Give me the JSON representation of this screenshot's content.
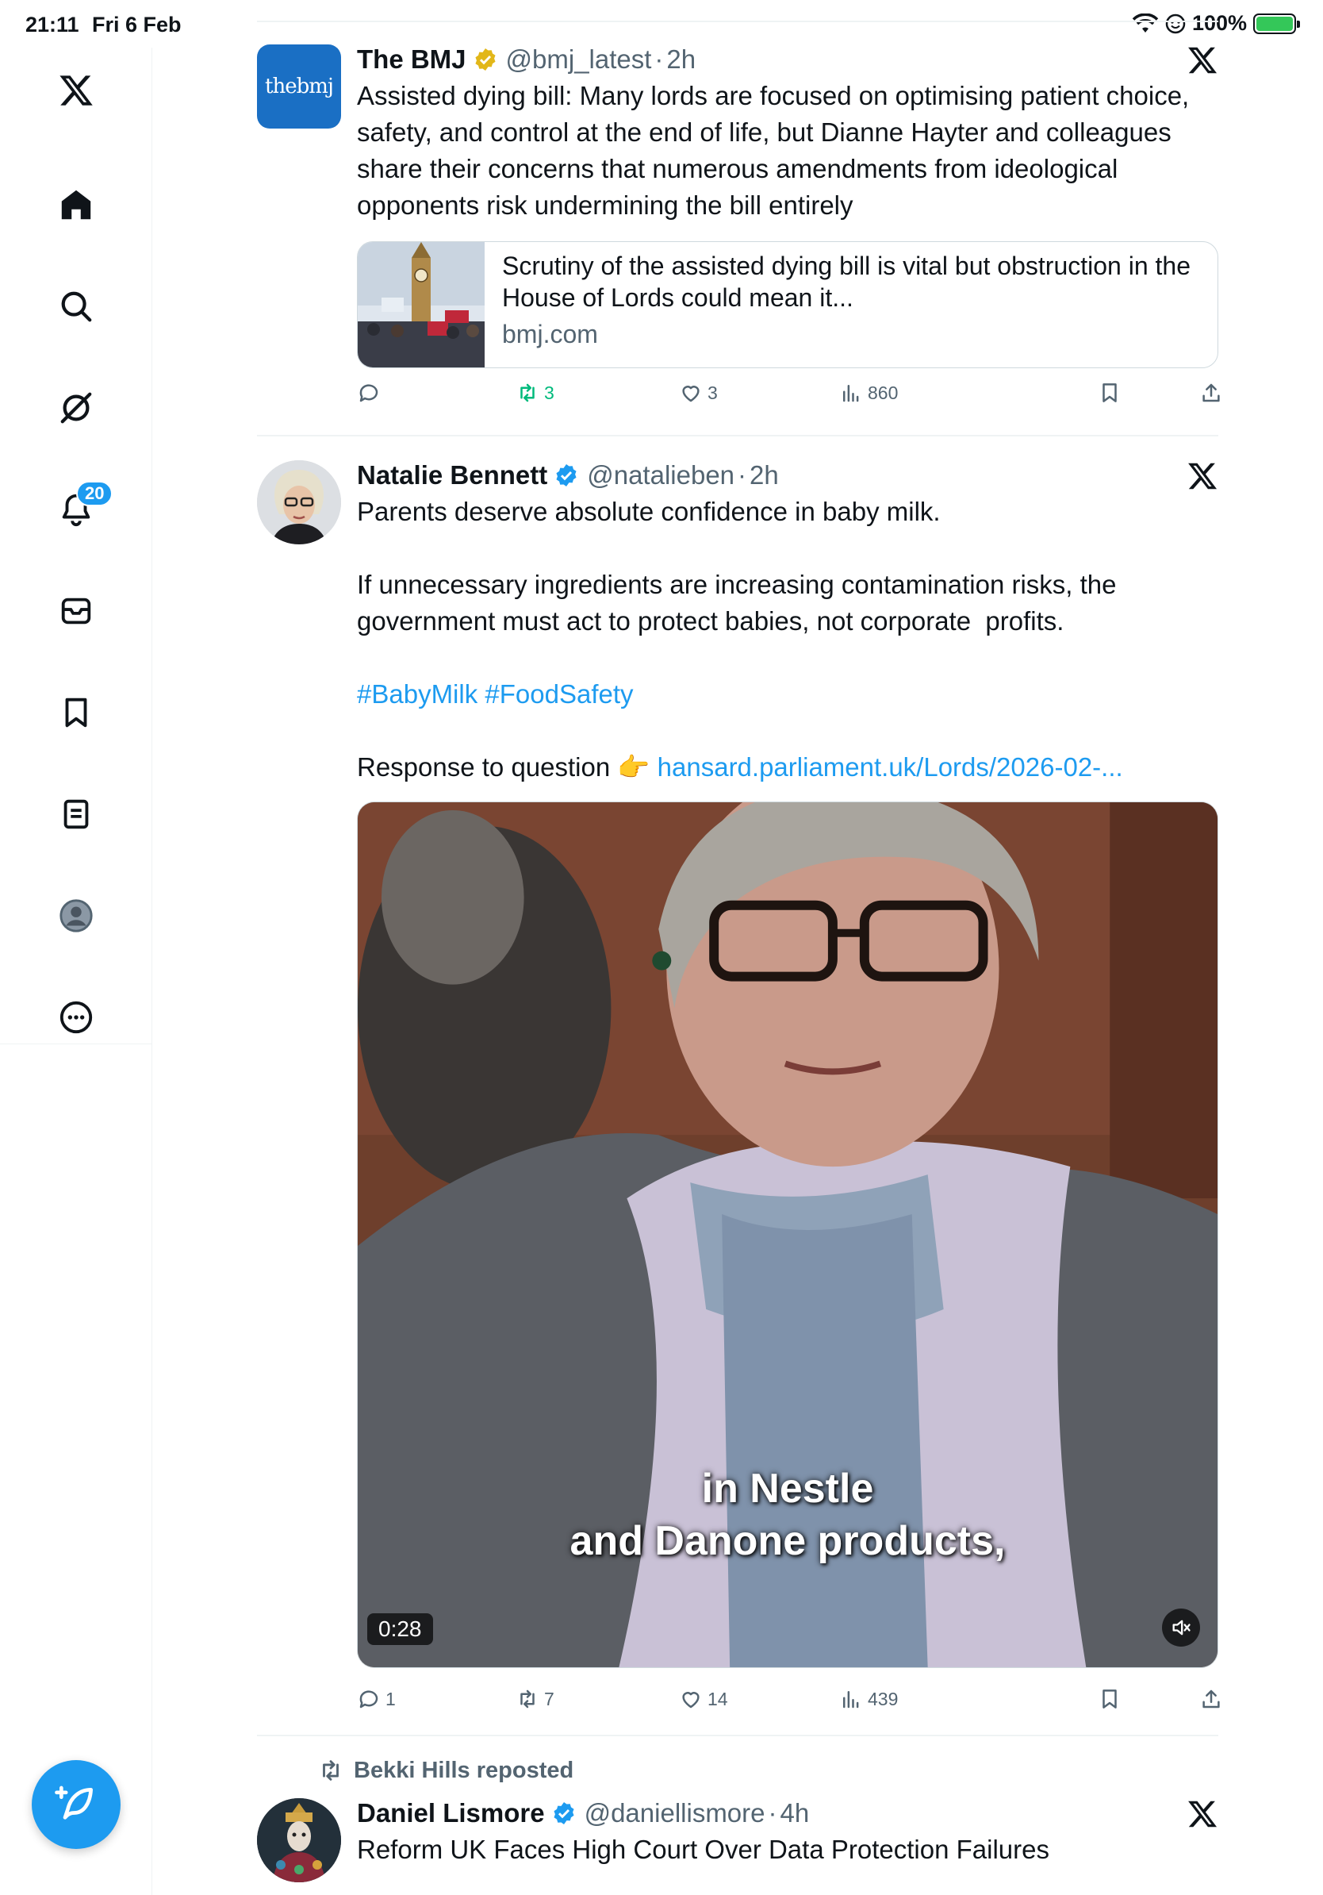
{
  "status_bar": {
    "time": "21:11",
    "date": "Fri 6 Feb",
    "battery": "100%"
  },
  "sidebar": {
    "items": [
      {
        "name": "x-logo"
      },
      {
        "name": "home"
      },
      {
        "name": "search"
      },
      {
        "name": "grok"
      },
      {
        "name": "notifications",
        "badge": "20"
      },
      {
        "name": "messages"
      },
      {
        "name": "bookmarks"
      },
      {
        "name": "lists"
      },
      {
        "name": "profile"
      },
      {
        "name": "more"
      }
    ]
  },
  "tweets": [
    {
      "name": "The BMJ",
      "handle": "@bmj_latest",
      "time": "2h",
      "avatar_text": "thebmj",
      "text": "Assisted dying bill: Many lords are focused on optimising patient choice, safety, and control at the end of life, but Dianne Hayter and colleagues share their concerns that numerous amendments from ideological opponents risk undermining the bill entirely",
      "card": {
        "title": "Scrutiny of the assisted dying bill is vital but obstruction in the House of Lords could mean it...",
        "domain": "bmj.com"
      },
      "stats": {
        "reposts": "3",
        "likes": "3",
        "views": "860"
      }
    },
    {
      "name": "Natalie Bennett",
      "handle": "@natalieben",
      "time": "2h",
      "text_1": "Parents deserve absolute confidence in baby milk.",
      "text_2": "If unnecessary ingredients are increasing contamination risks, the government must act to protect babies, not corporate  profits.",
      "hashtags": "#BabyMilk #FoodSafety",
      "response_prefix": "Response to question 👉 ",
      "link": "hansard.parliament.uk/Lords/2026-02-...",
      "video": {
        "caption_1": "in Nestle",
        "caption_2": "and Danone products,",
        "duration": "0:28"
      },
      "stats": {
        "replies": "1",
        "reposts": "7",
        "likes": "14",
        "views": "439"
      }
    },
    {
      "reposted_by": "Bekki Hills reposted",
      "name": "Daniel Lismore",
      "handle": "@daniellismore",
      "time": "4h",
      "text": "Reform UK Faces High Court Over Data Protection Failures"
    }
  ],
  "colors": {
    "accent": "#1d9bf0",
    "repost_green": "#00ba7c",
    "verified_gold": "#e2b719",
    "bmj_blue": "#1a6fc4"
  }
}
